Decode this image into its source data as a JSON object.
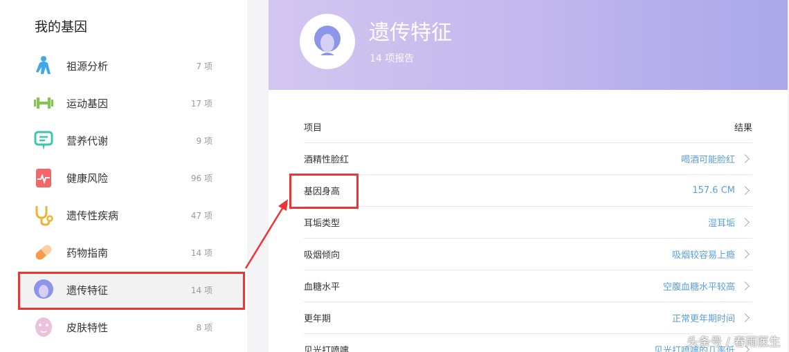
{
  "sidebar": {
    "title": "我的基因",
    "items": [
      {
        "label": "祖源分析",
        "count": "7 项",
        "icon": "ape-icon",
        "color": "#42a7e6"
      },
      {
        "label": "运动基因",
        "count": "17 项",
        "icon": "dumbbell-icon",
        "color": "#7cc84a"
      },
      {
        "label": "营养代谢",
        "count": "9 项",
        "icon": "stomach-icon",
        "color": "#3cc5b0"
      },
      {
        "label": "健康风险",
        "count": "96 项",
        "icon": "heart-monitor-icon",
        "color": "#f26868"
      },
      {
        "label": "遗传性疾病",
        "count": "47 项",
        "icon": "stethoscope-icon",
        "color": "#f2b230"
      },
      {
        "label": "药物指南",
        "count": "14 项",
        "icon": "pill-icon",
        "color": "#f59a4a"
      },
      {
        "label": "遗传特征",
        "count": "14 项",
        "icon": "face-icon",
        "color": "#8c96e8"
      },
      {
        "label": "皮肤特性",
        "count": "8 项",
        "icon": "face-mask-icon",
        "color": "#e6a5c8"
      }
    ]
  },
  "hero": {
    "title": "遗传特征",
    "subtitle": "14 项报告"
  },
  "table": {
    "header_item": "项目",
    "header_result": "结果",
    "rows": [
      {
        "name": "酒精性脸红",
        "result": "喝酒可能脸红"
      },
      {
        "name": "基因身高",
        "result": "157.6 CM"
      },
      {
        "name": "耳垢类型",
        "result": "湿耳垢"
      },
      {
        "name": "吸烟倾向",
        "result": "吸烟较容易上瘾"
      },
      {
        "name": "血糖水平",
        "result": "空腹血糖水平较高"
      },
      {
        "name": "更年期",
        "result": "正常更年期时间"
      },
      {
        "name": "见光打喷嚏",
        "result": "见光打喷嚏的几率低"
      }
    ]
  },
  "watermark": "头条号 / 春雨医生",
  "colors": {
    "accent": "#5aa0d8",
    "highlight": "#e33333"
  }
}
